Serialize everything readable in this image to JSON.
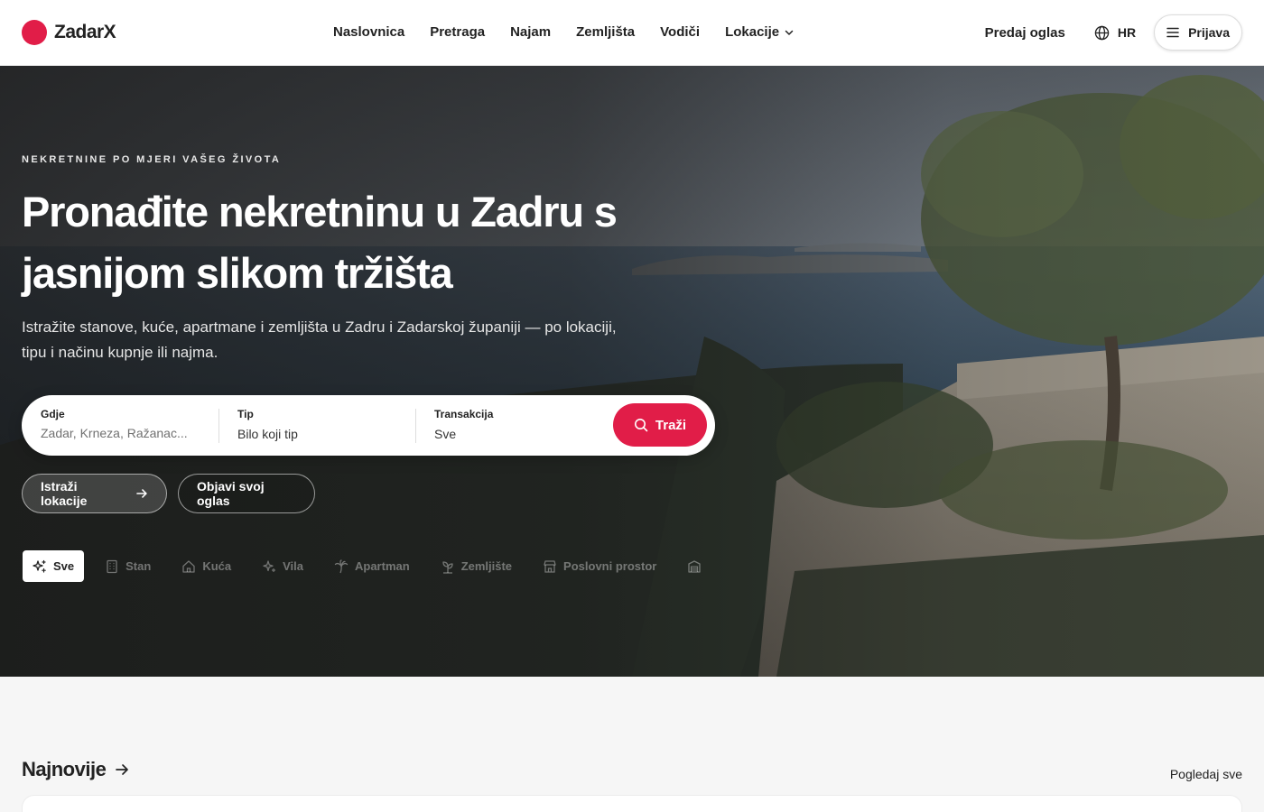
{
  "brand": {
    "name": "ZadarX",
    "color": "#e11d48"
  },
  "nav": {
    "items": [
      "Naslovnica",
      "Pretraga",
      "Najam",
      "Zemljišta",
      "Vodiči"
    ],
    "dropdown_label": "Lokacije"
  },
  "header": {
    "sell_label": "Predaj oglas",
    "language": "HR",
    "login_label": "Prijava"
  },
  "hero": {
    "eyebrow": "NEKRETNINE PO MJERI VAŠEG ŽIVOTA",
    "title_line1": "Pronađite nekretninu u Zadru s",
    "title_line2": "jasnijom slikom tržišta",
    "subtitle_line1": "Istražite stanove, kuće, apartmane i zemljišta u Zadru i Zadarskoj županiji — po lokaciji,",
    "subtitle_line2": "tipu i načinu kupnje ili najma."
  },
  "search": {
    "location": {
      "label": "Gdje",
      "placeholder": "Zadar, Krneza, Ražanac..."
    },
    "type": {
      "label": "Tip",
      "value": "Bilo koji tip"
    },
    "transaction": {
      "label": "Transakcija",
      "value": "Sve"
    },
    "button_label": "Traži"
  },
  "cta": {
    "primary_label": "Istraži lokacije",
    "secondary_label": "Objavi svoj oglas"
  },
  "categories": [
    {
      "label": "Sve",
      "icon": "sparkles-icon",
      "active": true
    },
    {
      "label": "Stan",
      "icon": "building-icon",
      "active": false
    },
    {
      "label": "Kuća",
      "icon": "home-icon",
      "active": false
    },
    {
      "label": "Vila",
      "icon": "sparkle-icon",
      "active": false
    },
    {
      "label": "Apartman",
      "icon": "palm-tree-icon",
      "active": false
    },
    {
      "label": "Zemljište",
      "icon": "sprout-icon",
      "active": false
    },
    {
      "label": "Poslovni prostor",
      "icon": "store-icon",
      "active": false
    },
    {
      "label": "",
      "icon": "garage-icon",
      "active": false
    }
  ],
  "latest": {
    "title": "Najnovije",
    "see_all": "Pogledaj sve"
  }
}
